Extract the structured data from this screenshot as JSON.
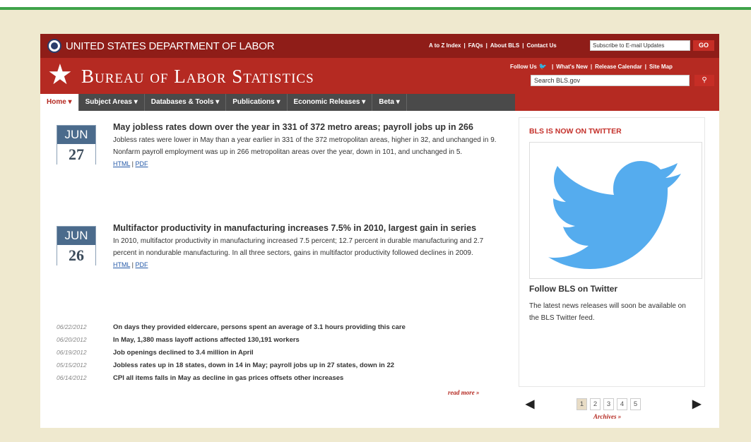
{
  "dol": {
    "title": "UNITED STATES DEPARTMENT OF LABOR",
    "util_links": [
      "A to Z Index",
      "FAQs",
      "About BLS",
      "Contact Us"
    ],
    "subscribe_placeholder": "Subscribe to E-mail Updates",
    "go_label": "GO"
  },
  "bls": {
    "title": "Bureau of Labor Statistics",
    "follow_links": [
      "Follow Us",
      "What's New",
      "Release Calendar",
      "Site Map"
    ],
    "search_placeholder": "Search BLS.gov",
    "search_icon": "search-icon"
  },
  "nav": [
    {
      "label": "Home ▾"
    },
    {
      "label": "Subject Areas ▾"
    },
    {
      "label": "Databases & Tools ▾"
    },
    {
      "label": "Publications ▾"
    },
    {
      "label": "Economic Releases ▾"
    },
    {
      "label": "Beta ▾"
    }
  ],
  "stories": [
    {
      "month": "JUN",
      "day": "27",
      "title": "May jobless rates down over the year in 331 of 372 metro areas; payroll jobs up in 266",
      "text": "Jobless rates were lower in May than a year earlier in 331 of the 372 metropolitan areas, higher in 32, and unchanged in 9. Nonfarm payroll employment was up in 266 metropolitan areas over the year, down in 101, and unchanged in 5.",
      "html": "HTML",
      "pdf": "PDF"
    },
    {
      "month": "JUN",
      "day": "26",
      "title": "Multifactor productivity in manufacturing increases 7.5% in 2010, largest gain in series",
      "text": "In 2010, multifactor productivity in manufacturing increased 7.5 percent; 12.7 percent in durable manufacturing and 2.7 percent in nondurable manufacturing. In all three sectors, gains in multifactor productivity followed declines in 2009.",
      "html": "HTML",
      "pdf": "PDF"
    }
  ],
  "recent": [
    {
      "date": "06/22/2012",
      "text": "On days they provided eldercare, persons spent an average of 3.1 hours providing this care"
    },
    {
      "date": "06/20/2012",
      "text": "In May, 1,380 mass layoff actions affected 130,191 workers"
    },
    {
      "date": "06/19/2012",
      "text": "Job openings declined to 3.4 million in April"
    },
    {
      "date": "05/15/2012",
      "text": "Jobless rates up in 18 states, down in 14 in May; payroll jobs up in 27 states, down in 22"
    },
    {
      "date": "06/14/2012",
      "text": "CPI all items falls in May as decline in gas prices offsets other increases"
    }
  ],
  "read_more": "read more »",
  "side": {
    "title": "BLS IS NOW ON TWITTER",
    "follow_title": "Follow BLS on Twitter",
    "follow_text": "The latest news releases will soon be available on the BLS Twitter feed.",
    "bird_color": "#55acee"
  },
  "pager": {
    "prev": "◀",
    "next": "▶",
    "pages": [
      "1",
      "2",
      "3",
      "4",
      "5"
    ],
    "archives": "Archives »"
  },
  "colors": {
    "dol_bar": "#8f1d18",
    "bls_bar": "#b52a22",
    "nav_bg": "#4a4a4a",
    "date_box": "#4b6b8c",
    "link": "#2459a8"
  }
}
